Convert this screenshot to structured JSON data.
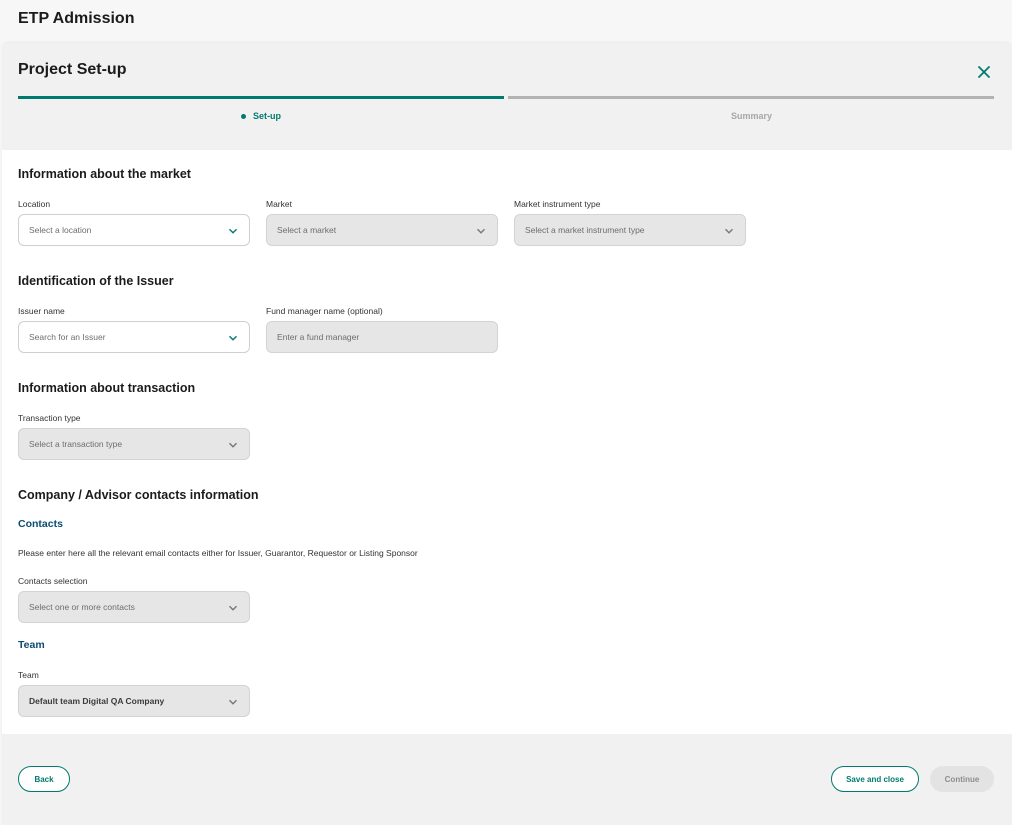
{
  "app": {
    "title": "ETP Admission"
  },
  "dialog": {
    "title": "Project Set-up",
    "steps": [
      {
        "label": "Set-up",
        "state": "active"
      },
      {
        "label": "Summary",
        "state": "inactive"
      }
    ]
  },
  "sections": {
    "market": {
      "title": "Information about the market",
      "location": {
        "label": "Location",
        "placeholder": "Select a location"
      },
      "market": {
        "label": "Market",
        "placeholder": "Select a market"
      },
      "instrument": {
        "label": "Market instrument type",
        "placeholder": "Select a market instrument type"
      }
    },
    "issuer": {
      "title": "Identification of the Issuer",
      "issuer_name": {
        "label": "Issuer name",
        "placeholder": "Search for an Issuer"
      },
      "fund_manager": {
        "label": "Fund manager name (optional)",
        "placeholder": "Enter a fund manager"
      }
    },
    "transaction": {
      "title": "Information about transaction",
      "type": {
        "label": "Transaction type",
        "placeholder": "Select a transaction type"
      }
    },
    "contacts": {
      "title": "Company / Advisor contacts information",
      "contacts_subtitle": "Contacts",
      "help": "Please enter here all the relevant email contacts either for Issuer, Guarantor, Requestor or Listing Sponsor",
      "selection": {
        "label": "Contacts selection",
        "placeholder": "Select one or more contacts"
      },
      "team_subtitle": "Team",
      "team": {
        "label": "Team",
        "value": "Default team Digital QA Company"
      }
    }
  },
  "footer": {
    "back": "Back",
    "save_close": "Save and close",
    "continue": "Continue"
  },
  "colors": {
    "accent": "#007a6f",
    "subtitle": "#0a4c73"
  },
  "icons": {
    "close": "close-icon",
    "chevron": "chevron-down-icon"
  }
}
